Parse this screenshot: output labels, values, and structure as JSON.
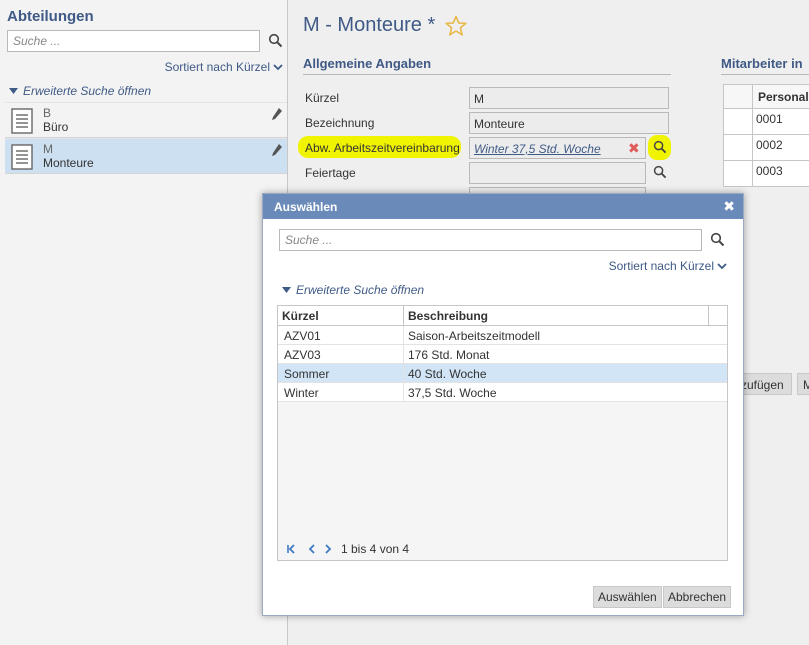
{
  "sidebar": {
    "title": "Abteilungen",
    "search_placeholder": "Suche ...",
    "sort_label": "Sortiert nach Kürzel",
    "advanced_search": "Erweiterte Suche öffnen",
    "items": [
      {
        "code": "B",
        "name": "Büro",
        "selected": false
      },
      {
        "code": "M",
        "name": "Monteure",
        "selected": true
      }
    ]
  },
  "main": {
    "title": "M - Monteure *",
    "section_general": "Allgemeine Angaben",
    "section_employees": "Mitarbeiter in",
    "fields": {
      "kuerzel_label": "Kürzel",
      "kuerzel_value": "M",
      "bezeichnung_label": "Bezeichnung",
      "bezeichnung_value": "Monteure",
      "arbeitszeit_label": "Abw. Arbeitszeitvereinbarung",
      "arbeitszeit_value": "Winter 37,5 Std. Woche",
      "feiertage_label": "Feiertage",
      "feiertage_value": ""
    },
    "employees": {
      "header": "Personal",
      "rows": [
        "0001",
        "0002",
        "0003"
      ]
    },
    "bg_buttons": {
      "add": "zufügen",
      "more": "M"
    }
  },
  "dialog": {
    "title": "Auswählen",
    "close_glyph": "✖",
    "search_placeholder": "Suche ...",
    "sort_label": "Sortiert nach Kürzel",
    "advanced_search": "Erweiterte Suche öffnen",
    "columns": [
      "Kürzel",
      "Beschreibung"
    ],
    "rows": [
      {
        "code": "AZV01",
        "desc": "Saison-Arbeitszeitmodell",
        "selected": false
      },
      {
        "code": "AZV03",
        "desc": "176 Std. Monat",
        "selected": false
      },
      {
        "code": "Sommer",
        "desc": "40 Std. Woche",
        "selected": true
      },
      {
        "code": "Winter",
        "desc": "37,5 Std. Woche",
        "selected": false
      }
    ],
    "pager_text": "1 bis 4 von 4",
    "btn_select": "Auswählen",
    "btn_cancel": "Abbrechen"
  },
  "colors": {
    "accent": "#3f5a86",
    "dialog_header": "#6a8bba",
    "selection": "#cde0f2",
    "highlight": "#f0f400",
    "clear": "#e05a5a"
  }
}
